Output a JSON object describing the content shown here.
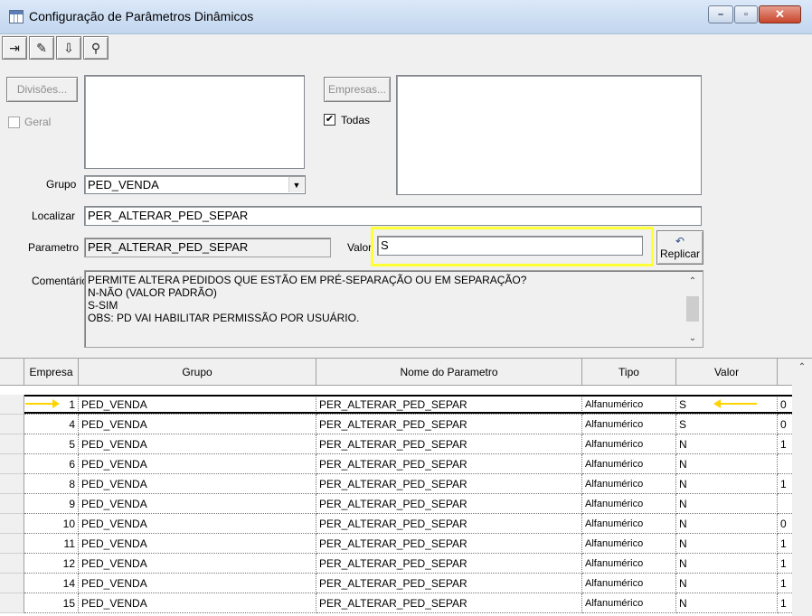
{
  "window": {
    "title": "Configuração de Parâmetros Dinâmicos",
    "minimize": "–",
    "maximize": "▫",
    "close": "✕"
  },
  "toolbar": {
    "exit_glyph": "⇥",
    "eraser_glyph": "✎",
    "save_glyph": "⇩",
    "find_glyph": "⚲"
  },
  "filters": {
    "divisoes_label": "Divisões...",
    "geral_label": "Geral",
    "geral_checked": false,
    "empresas_label": "Empresas...",
    "todas_label": "Todas",
    "todas_check": "✔",
    "grupo_label": "Grupo",
    "grupo_value": "PED_VENDA",
    "grupo_arrow": "▼",
    "localizar_label": "Localizar",
    "localizar_value": "PER_ALTERAR_PED_SEPAR",
    "parametro_label": "Parametro",
    "parametro_value": "PER_ALTERAR_PED_SEPAR",
    "valor_label": "Valor",
    "valor_value": "S",
    "replicar_icon": "↶",
    "replicar_label": "Replicar",
    "comentarios_label": "Comentários",
    "comentarios_text": "PERMITE ALTERA PEDIDOS QUE ESTÃO EM PRÉ-SEPARAÇÃO OU EM SEPARAÇÃO?\nN-NÃO (VALOR PADRÃO)\nS-SIM\nOBS: PD VAI HABILITAR PERMISSÃO POR USUÁRIO.",
    "scroll_up": "⌃",
    "scroll_down": "⌄"
  },
  "grid": {
    "headers": {
      "empresa": "Empresa",
      "grupo": "Grupo",
      "nome": "Nome do Parametro",
      "tipo": "Tipo",
      "valor": "Valor"
    },
    "scroll_up": "⌃",
    "rows": [
      {
        "empresa": "1",
        "grupo": "PED_VENDA",
        "nome": "PER_ALTERAR_PED_SEPAR",
        "tipo": "Alfanumérico",
        "valor": "S",
        "extra": "0"
      },
      {
        "empresa": "4",
        "grupo": "PED_VENDA",
        "nome": "PER_ALTERAR_PED_SEPAR",
        "tipo": "Alfanumérico",
        "valor": "S",
        "extra": "0"
      },
      {
        "empresa": "5",
        "grupo": "PED_VENDA",
        "nome": "PER_ALTERAR_PED_SEPAR",
        "tipo": "Alfanumérico",
        "valor": "N",
        "extra": "1"
      },
      {
        "empresa": "6",
        "grupo": "PED_VENDA",
        "nome": "PER_ALTERAR_PED_SEPAR",
        "tipo": "Alfanumérico",
        "valor": "N",
        "extra": ""
      },
      {
        "empresa": "8",
        "grupo": "PED_VENDA",
        "nome": "PER_ALTERAR_PED_SEPAR",
        "tipo": "Alfanumérico",
        "valor": "N",
        "extra": "1"
      },
      {
        "empresa": "9",
        "grupo": "PED_VENDA",
        "nome": "PER_ALTERAR_PED_SEPAR",
        "tipo": "Alfanumérico",
        "valor": "N",
        "extra": ""
      },
      {
        "empresa": "10",
        "grupo": "PED_VENDA",
        "nome": "PER_ALTERAR_PED_SEPAR",
        "tipo": "Alfanumérico",
        "valor": "N",
        "extra": "0"
      },
      {
        "empresa": "11",
        "grupo": "PED_VENDA",
        "nome": "PER_ALTERAR_PED_SEPAR",
        "tipo": "Alfanumérico",
        "valor": "N",
        "extra": "1"
      },
      {
        "empresa": "12",
        "grupo": "PED_VENDA",
        "nome": "PER_ALTERAR_PED_SEPAR",
        "tipo": "Alfanumérico",
        "valor": "N",
        "extra": "1"
      },
      {
        "empresa": "14",
        "grupo": "PED_VENDA",
        "nome": "PER_ALTERAR_PED_SEPAR",
        "tipo": "Alfanumérico",
        "valor": "N",
        "extra": "1"
      },
      {
        "empresa": "15",
        "grupo": "PED_VENDA",
        "nome": "PER_ALTERAR_PED_SEPAR",
        "tipo": "Alfanumérico",
        "valor": "N",
        "extra": "1"
      }
    ]
  }
}
